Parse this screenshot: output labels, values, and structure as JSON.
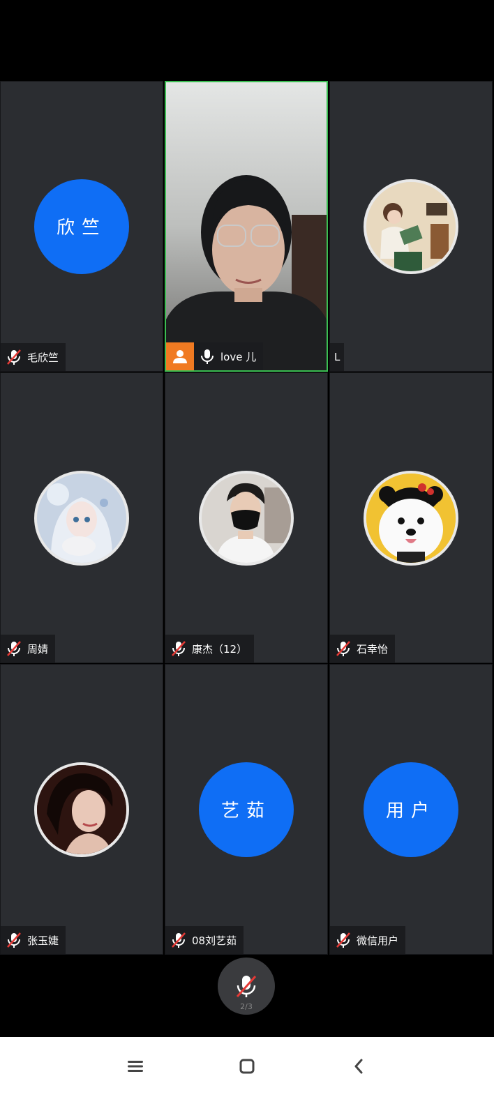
{
  "tiles": [
    {
      "name": "毛欣竺",
      "avatar_text": "欣竺",
      "avatar_type": "text",
      "muted": true
    },
    {
      "name": "love 儿",
      "avatar_type": "video",
      "muted": false,
      "active": true
    },
    {
      "name": "L",
      "avatar_type": "image",
      "muted": false
    },
    {
      "name": "周婧",
      "avatar_type": "image",
      "muted": true
    },
    {
      "name": "康杰（12）",
      "avatar_type": "image",
      "muted": true
    },
    {
      "name": "石幸怡",
      "avatar_type": "image",
      "muted": true
    },
    {
      "name": "张玉婕",
      "avatar_type": "image",
      "muted": true
    },
    {
      "name": "08刘艺茹",
      "avatar_text": "艺茹",
      "avatar_type": "text",
      "muted": true
    },
    {
      "name": "微信用户",
      "avatar_text": "用户",
      "avatar_type": "text",
      "muted": true
    }
  ],
  "controls": {
    "main_mic_icon": "mic-muted-icon",
    "page_indicator": "2/3"
  },
  "colors": {
    "tile_bg": "#2b2d31",
    "avatar_blue": "#0f6ef5",
    "active_border": "#3bbd52",
    "camera_badge": "#f07a22",
    "muted_slash": "#e53935"
  },
  "navbar": {
    "icons": [
      "menu-icon",
      "home-icon",
      "back-icon"
    ]
  }
}
